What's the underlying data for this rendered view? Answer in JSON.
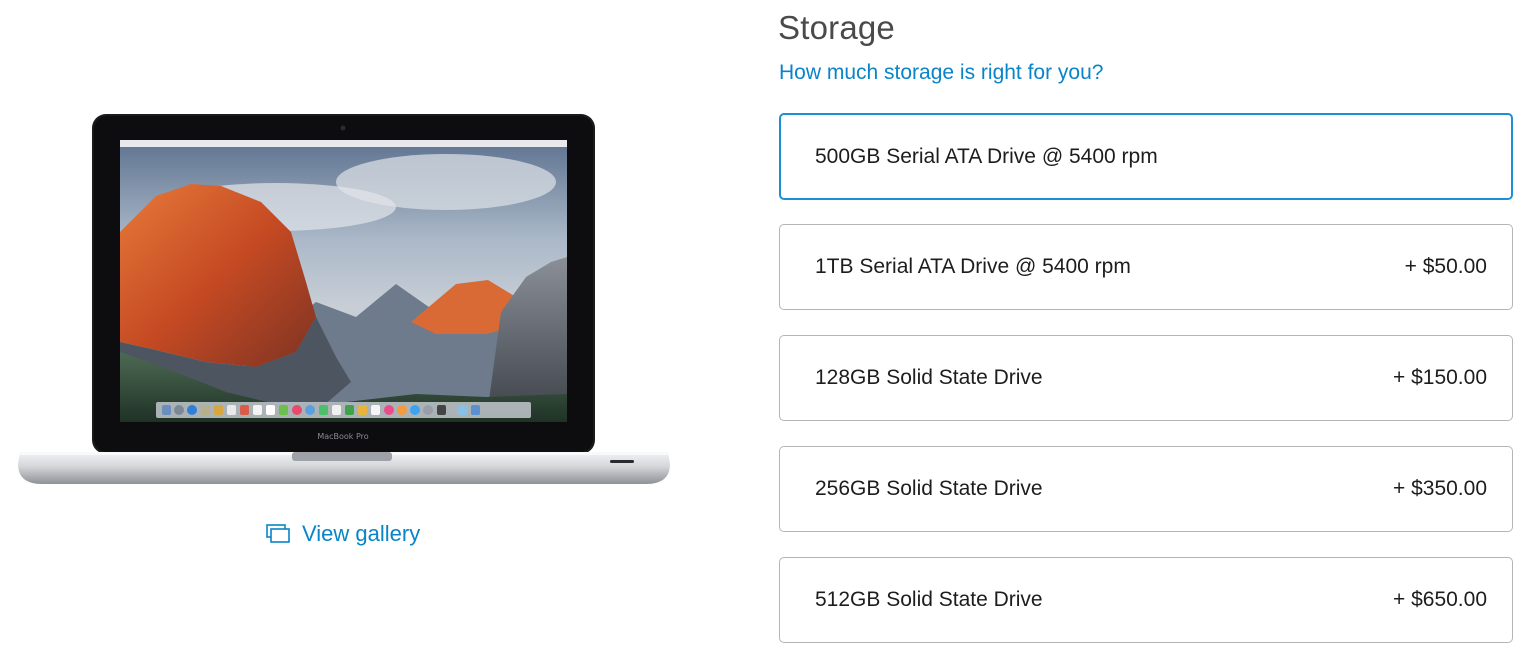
{
  "product": {
    "image_alt": "MacBook Pro",
    "bezel_label": "MacBook Pro",
    "gallery_link": "View gallery"
  },
  "storage": {
    "title": "Storage",
    "help_link": "How much storage is right for you?",
    "selected_index": 0,
    "options": [
      {
        "label": "500GB Serial ATA Drive @ 5400 rpm",
        "price": ""
      },
      {
        "label": "1TB Serial ATA Drive @ 5400 rpm",
        "price": "+ $50.00"
      },
      {
        "label": "128GB Solid State Drive",
        "price": "+ $150.00"
      },
      {
        "label": "256GB Solid State Drive",
        "price": "+ $350.00"
      },
      {
        "label": "512GB Solid State Drive",
        "price": "+ $650.00"
      }
    ]
  },
  "colors": {
    "link": "#0a84c9",
    "selected_border": "#1d8fd6",
    "option_border": "#b5b5b8",
    "title": "#4a4a4d"
  },
  "icons": {
    "gallery": "gallery-icon"
  }
}
